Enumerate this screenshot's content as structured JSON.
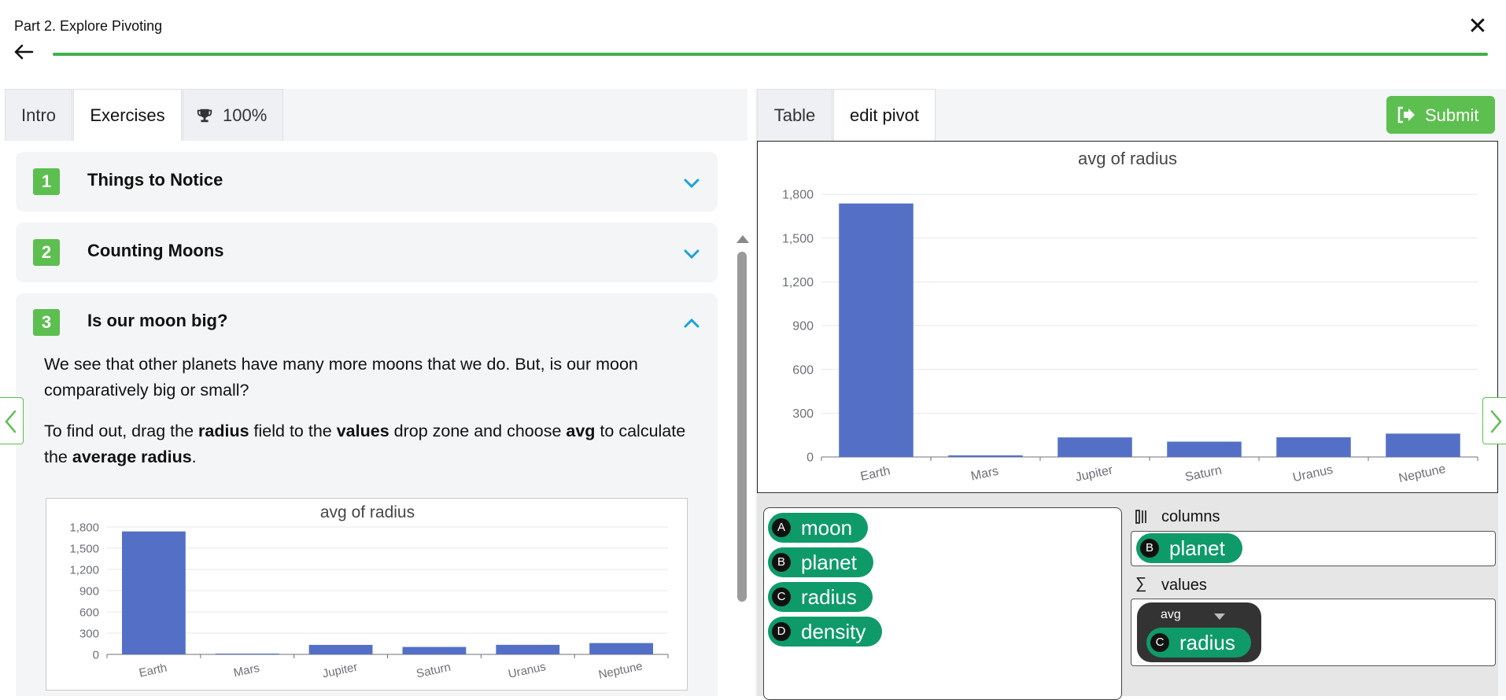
{
  "header": {
    "title": "Part 2. Explore Pivoting",
    "close_glyph": "✕",
    "progress_fraction": 1.0
  },
  "left_tabs": [
    {
      "label": "Intro"
    },
    {
      "label": "Exercises"
    },
    {
      "label": "100%"
    }
  ],
  "cards": [
    {
      "num": "1",
      "title": "Things to Notice"
    },
    {
      "num": "2",
      "title": "Counting Moons"
    },
    {
      "num": "3",
      "title": "Is our moon big?"
    }
  ],
  "card3": {
    "para1": "We see that other planets have many more moons that we do. But, is our moon comparatively big or small?",
    "para2": {
      "t1": "To find out, drag the ",
      "b1": "radius",
      "t2": " field to the ",
      "b2": "values",
      "t3": " drop zone and choose ",
      "b3": "avg",
      "t4": " to calculate the ",
      "b4": "average radius",
      "t5": "."
    }
  },
  "right_tabs": [
    {
      "label": "Table"
    },
    {
      "label": "edit pivot"
    }
  ],
  "submit": {
    "label": "Submit"
  },
  "pivot": {
    "fields": [
      {
        "letter": "A",
        "name": "moon"
      },
      {
        "letter": "B",
        "name": "planet"
      },
      {
        "letter": "C",
        "name": "radius"
      },
      {
        "letter": "D",
        "name": "density"
      }
    ],
    "columns_label": "columns",
    "values_label": "values",
    "column_pill": {
      "letter": "B",
      "name": "planet"
    },
    "value_agg": "avg",
    "value_pill": {
      "letter": "C",
      "name": "radius"
    }
  },
  "colors": {
    "accent_green": "#5cbf4f",
    "pill_green": "#0f9a6a",
    "bar_blue": "#5470c6"
  },
  "icons": {
    "back": "arrow-left-icon",
    "close": "close-icon",
    "trophy": "trophy-icon",
    "submit": "submit-arrow-icon",
    "columns": "columns-icon",
    "values": "sigma-icon"
  },
  "chart_data": [
    {
      "type": "bar",
      "title": "avg of radius",
      "categories": [
        "Earth",
        "Mars",
        "Jupiter",
        "Saturn",
        "Uranus",
        "Neptune"
      ],
      "values": [
        1737,
        11,
        134,
        105,
        135,
        160
      ],
      "ylim": [
        0,
        1800
      ],
      "yticks": [
        0,
        300,
        600,
        900,
        1200,
        1500,
        1800
      ],
      "ytick_labels": [
        "0",
        "300",
        "600",
        "900",
        "1,200",
        "1,500",
        "1,800"
      ],
      "grid": true
    },
    {
      "type": "bar",
      "title": "avg of radius",
      "categories": [
        "Earth",
        "Mars",
        "Jupiter",
        "Saturn",
        "Uranus",
        "Neptune"
      ],
      "values": [
        1737,
        11,
        134,
        105,
        135,
        160
      ],
      "ylim": [
        0,
        1800
      ],
      "yticks": [
        0,
        300,
        600,
        900,
        1200,
        1500,
        1800
      ],
      "ytick_labels": [
        "0",
        "300",
        "600",
        "900",
        "1,200",
        "1,500",
        "1,800"
      ],
      "grid": true
    }
  ]
}
